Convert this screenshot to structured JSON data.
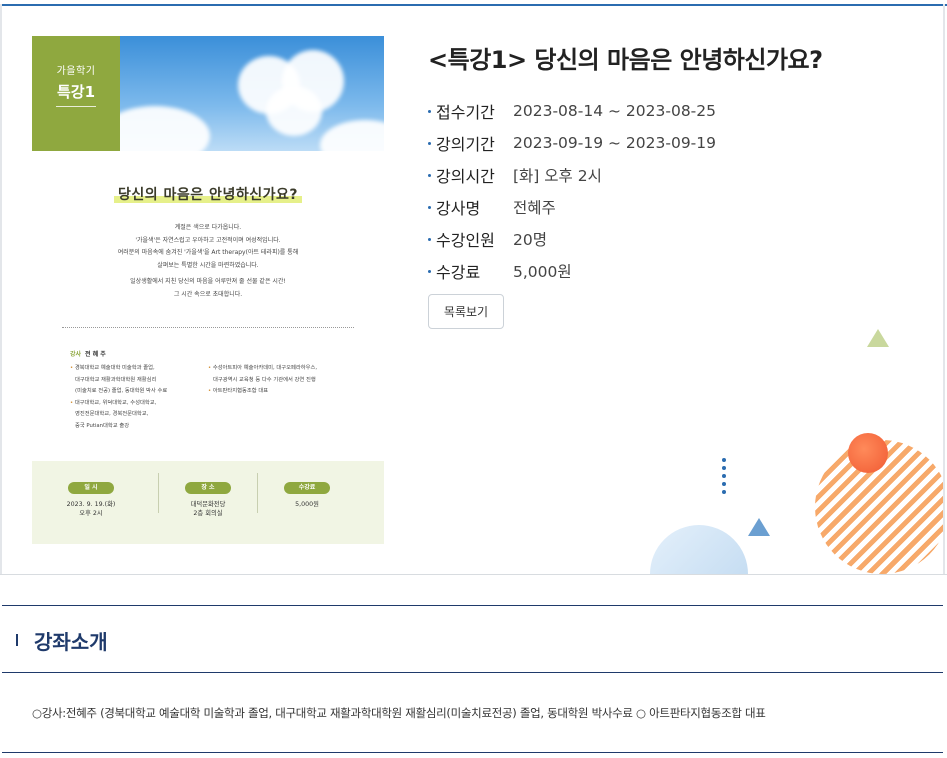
{
  "poster": {
    "badge_top": "가을학기",
    "badge_main": "특강1",
    "title": "당신의 마음은 안녕하신가요?",
    "desc": [
      "계절은 색으로 다가옵니다.",
      "'가을색'은 자연스럽고 우아하고 고전적이며 여성적입니다.",
      "여러분의 마음속에 숨겨진 '가을색'을 Art therapy(아트 테라피)를 통해",
      "살펴보는 특별한 시간을 마련하였습니다.",
      "일상생활에서 지친 당신의 마음을 어루만져 줄 선물 같은 시간!",
      "그 시간 속으로 초대합니다."
    ],
    "lecturer_tag": "강사",
    "lecturer_name": "전 혜 주",
    "career_left": [
      {
        "text": "경북대학교 예술대학 미술학과 졸업,",
        "bullet": true
      },
      {
        "text": "대구대학교 재활과학대학원 재활심리",
        "bullet": false
      },
      {
        "text": "(미술치료 전공) 졸업, 동대학원 박사 수료",
        "bullet": false
      },
      {
        "text": "대구대학교, 위덕대학교, 수성대학교,",
        "bullet": true
      },
      {
        "text": "영진전문대학교, 경북전문대학교,",
        "bullet": false
      },
      {
        "text": "중국 Putian대학교 출강",
        "bullet": false
      }
    ],
    "career_right": [
      {
        "text": "수성아트피아 예술아카데미, 대구오페라하우스,",
        "bullet": true
      },
      {
        "text": "대구광역시 교육청 등 다수 기관에서 강연 진행",
        "bullet": false
      },
      {
        "text": "아트판타지협동조합 대표",
        "bullet": true
      }
    ],
    "info": [
      {
        "label": "일 시",
        "value": [
          "2023. 9. 19.(화)",
          "오후 2시"
        ]
      },
      {
        "label": "장 소",
        "value": [
          "대덕문화전당",
          "2층 회의실"
        ]
      },
      {
        "label": "수강료",
        "value": [
          "5,000원"
        ]
      }
    ]
  },
  "lecture": {
    "title": "<특강1> 당신의 마음은 안녕하신가요?",
    "details": [
      {
        "label": "접수기간",
        "value": "2023-08-14 ~ 2023-08-25"
      },
      {
        "label": "강의기간",
        "value": "2023-09-19 ~ 2023-09-19"
      },
      {
        "label": "강의시간",
        "value": "[화] 오후 2시"
      },
      {
        "label": "강사명",
        "value": "전혜주"
      },
      {
        "label": "수강인원",
        "value": "20명"
      },
      {
        "label": "수강료",
        "value": "5,000원"
      }
    ],
    "list_button": "목록보기"
  },
  "intro": {
    "title": "강좌소개",
    "text": "○강사:전혜주 (경북대학교 예술대학 미술학과 졸업, 대구대학교 재활과학대학원 재활심리(미술치료전공) 졸업, 동대학원 박사수료 ○ 아트판타지협동조합 대표"
  },
  "colors": {
    "accent": "#2b6cb0",
    "navy": "#1f3a6b",
    "poster_green": "#8fa83f",
    "orange": "#f05a32"
  }
}
